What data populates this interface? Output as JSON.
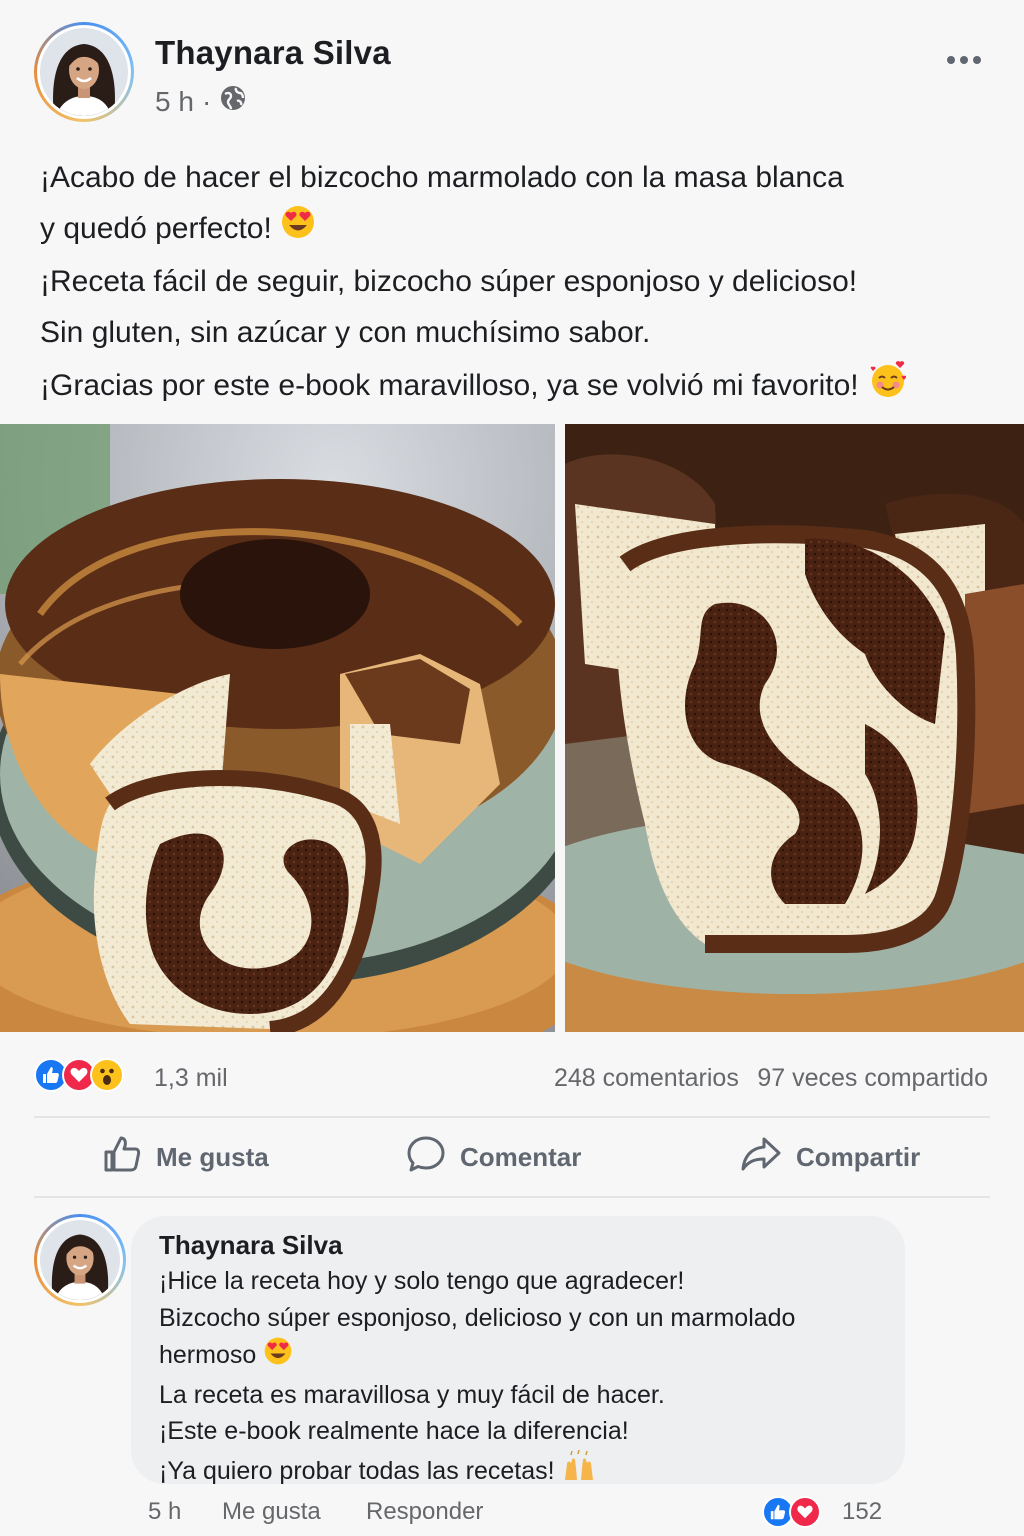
{
  "post": {
    "author": "Thaynara Silva",
    "time": "5 h",
    "separator": "·",
    "text_lines": [
      "¡Acabo de hacer el bizcocho marmolado con la masa blanca",
      "y quedó perfecto!",
      "¡Receta fácil de seguir, bizcocho súper esponjoso y delicioso!",
      "Sin gluten, sin azúcar y con muchísimo sabor.",
      "¡Gracias por este e-book maravilloso, ya se volvió mi favorito!"
    ],
    "emojis": [
      "heart-eyes-emoji",
      "smiling-face-with-hearts-emoji"
    ]
  },
  "stats": {
    "reaction_count": "1,3 mil",
    "comments": "248 comentarios",
    "shares": "97 veces compartido",
    "reaction_icons": [
      "like-icon",
      "love-icon",
      "wow-icon"
    ]
  },
  "actions": {
    "like": "Me gusta",
    "comment": "Comentar",
    "share": "Compartir"
  },
  "comment": {
    "author": "Thaynara Silva",
    "lines": [
      "¡Hice la receta hoy y solo tengo que agradecer!",
      "Bizcocho súper esponjoso, delicioso y con un marmolado",
      "hermoso",
      "La receta es maravillosa y muy fácil de hacer.",
      "¡Este e-book realmente hace la diferencia!",
      "¡Ya quiero probar todas las recetas!"
    ],
    "time": "5 h",
    "like": "Me gusta",
    "reply": "Responder",
    "reaction_count": "152",
    "reaction_icons": [
      "like-icon",
      "love-icon"
    ]
  },
  "colors": {
    "like_blue": "#1877f2",
    "love_red": "#f0284a",
    "text": "#1c1e21",
    "muted": "#65676b"
  }
}
